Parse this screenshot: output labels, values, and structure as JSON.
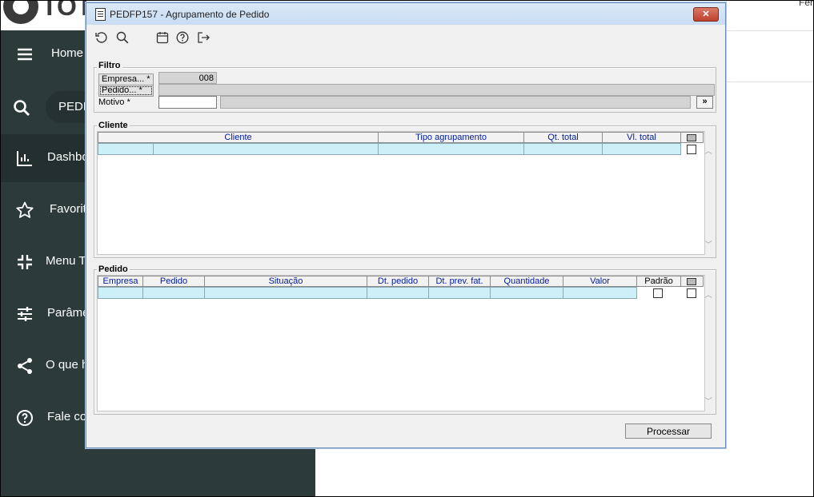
{
  "background": {
    "logo_text": "TOT",
    "top_right_text": "Fer",
    "search_value": "PEDF",
    "sidebar": [
      {
        "label": "Home",
        "icon": "menu-icon"
      },
      {
        "label": "Dashbo",
        "icon": "bar-chart-icon"
      },
      {
        "label": "Favorit",
        "icon": "star-icon"
      },
      {
        "label": "Menu T",
        "icon": "collapse-icon"
      },
      {
        "label": "Parâme",
        "icon": "sliders-icon"
      },
      {
        "label": "O que h",
        "icon": "share-icon"
      },
      {
        "label": "Fale co",
        "icon": "help-circle-icon"
      }
    ]
  },
  "dialog": {
    "title": "PEDFP157 - Agrupamento de Pedido",
    "close_label": "✕",
    "toolbar_icons": [
      "undo-icon",
      "search-icon",
      "calendar-icon",
      "help-icon",
      "exit-icon"
    ],
    "filtro": {
      "group_label": "Filtro",
      "empresa_label": "Empresa... *",
      "empresa_value": "008",
      "pedido_label": "Pedido... *",
      "motivo_label": "Motivo *",
      "more_label": "»"
    },
    "cliente": {
      "group_label": "Cliente",
      "columns": [
        "Cliente",
        "Tipo agrupamento",
        "Qt. total",
        "Vl. total"
      ]
    },
    "pedido": {
      "group_label": "Pedido",
      "columns": [
        "Empresa",
        "Pedido",
        "Situação",
        "Dt. pedido",
        "Dt. prev. fat.",
        "Quantidade",
        "Valor",
        "Padrão"
      ]
    },
    "process_button": "Processar"
  }
}
